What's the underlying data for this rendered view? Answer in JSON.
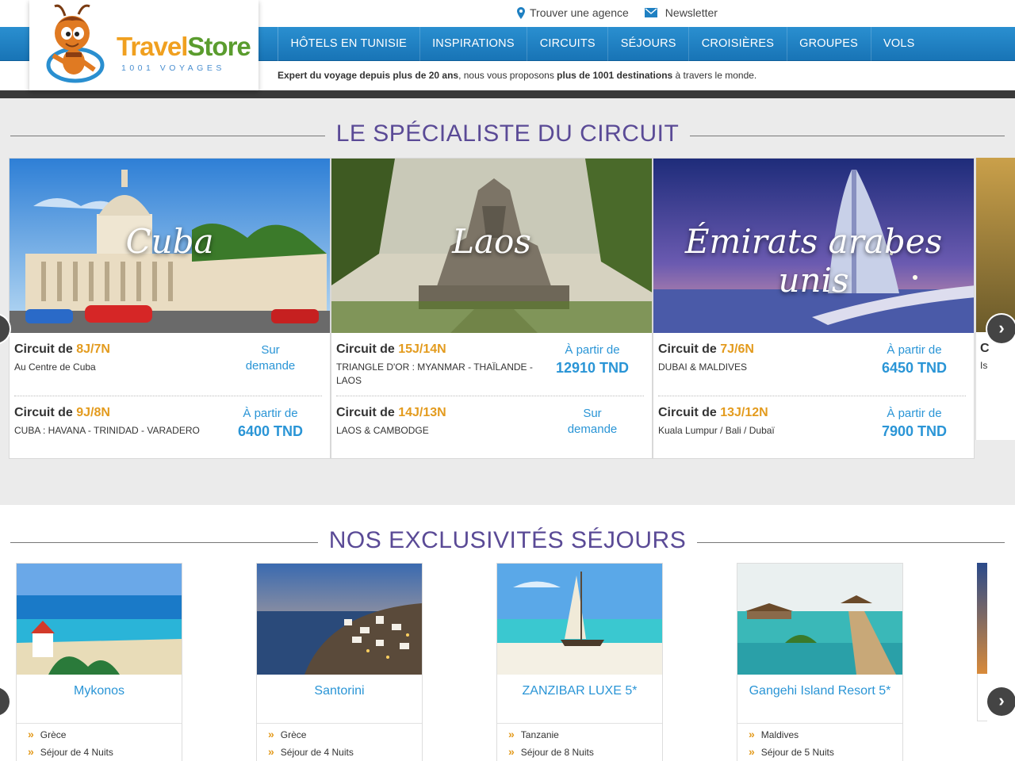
{
  "header": {
    "logo_title_a": "Travel",
    "logo_title_b": "Store",
    "logo_subtitle": "1001 VOYAGES",
    "top_links": [
      {
        "label": "Trouver une agence",
        "icon": "map-pin-icon"
      },
      {
        "label": "Newsletter",
        "icon": "envelope-icon"
      }
    ],
    "nav": [
      "HÔTELS EN TUNISIE",
      "INSPIRATIONS",
      "CIRCUITS",
      "SÉJOURS",
      "CROISIÈRES",
      "GROUPES",
      "VOLS"
    ],
    "tagline": {
      "b1": "Expert du voyage depuis plus de 20 ans",
      "t1": ", nous vous proposons ",
      "b2": "plus de 1001 destinations",
      "t2": " à travers le monde."
    }
  },
  "circuits": {
    "title": "LE SPÉCIALISTE DU CIRCUIT",
    "prefix": "Circuit de ",
    "cards": [
      {
        "destination": "Cuba",
        "offers": [
          {
            "duration": "8J/7N",
            "desc": "Au Centre de Cuba",
            "price_line1": "Sur",
            "price_line2": "demande"
          },
          {
            "duration": "9J/8N",
            "desc": "CUBA : HAVANA - TRINIDAD - VARADERO",
            "price_line1": "À partir de",
            "price_line2": "6400 TND"
          }
        ]
      },
      {
        "destination": "Laos",
        "offers": [
          {
            "duration": "15J/14N",
            "desc": "TRIANGLE D'OR : MYANMAR - THAÏLANDE - LAOS",
            "price_line1": "À partir de",
            "price_line2": "12910 TND"
          },
          {
            "duration": "14J/13N",
            "desc": "LAOS & CAMBODGE",
            "price_line1": "Sur",
            "price_line2": "demande"
          }
        ]
      },
      {
        "destination": "Émirats arabes unis",
        "offers": [
          {
            "duration": "7J/6N",
            "desc": "DUBAI & MALDIVES",
            "price_line1": "À partir de",
            "price_line2": "6450 TND"
          },
          {
            "duration": "13J/12N",
            "desc": "Kuala Lumpur / Bali / Dubaï",
            "price_line1": "À partir de",
            "price_line2": "7900 TND"
          }
        ]
      }
    ],
    "partial_card": {
      "title_fragment": "C",
      "desc_fragment": "Is"
    },
    "arrow_glyph": "›"
  },
  "sejours": {
    "title": "NOS EXCLUSIVITÉS SÉJOURS",
    "bullet_glyph": "»",
    "items": [
      {
        "name": "Mykonos",
        "country": "Grèce",
        "stay": "Séjour de 4 Nuits"
      },
      {
        "name": "Santorini",
        "country": "Grèce",
        "stay": "Séjour de 4 Nuits"
      },
      {
        "name": "ZANZIBAR LUXE 5*",
        "country": "Tanzanie",
        "stay": "Séjour de 8 Nuits"
      },
      {
        "name": "Gangehi Island Resort 5*",
        "country": "Maldives",
        "stay": "Séjour de 5 Nuits"
      }
    ]
  },
  "colors": {
    "nav_blue": "#1f80c2",
    "section_title_purple": "#5a4a96",
    "duration_orange": "#e39b1e",
    "price_blue": "#2a95d6",
    "circuits_background": "#ebebeb"
  }
}
